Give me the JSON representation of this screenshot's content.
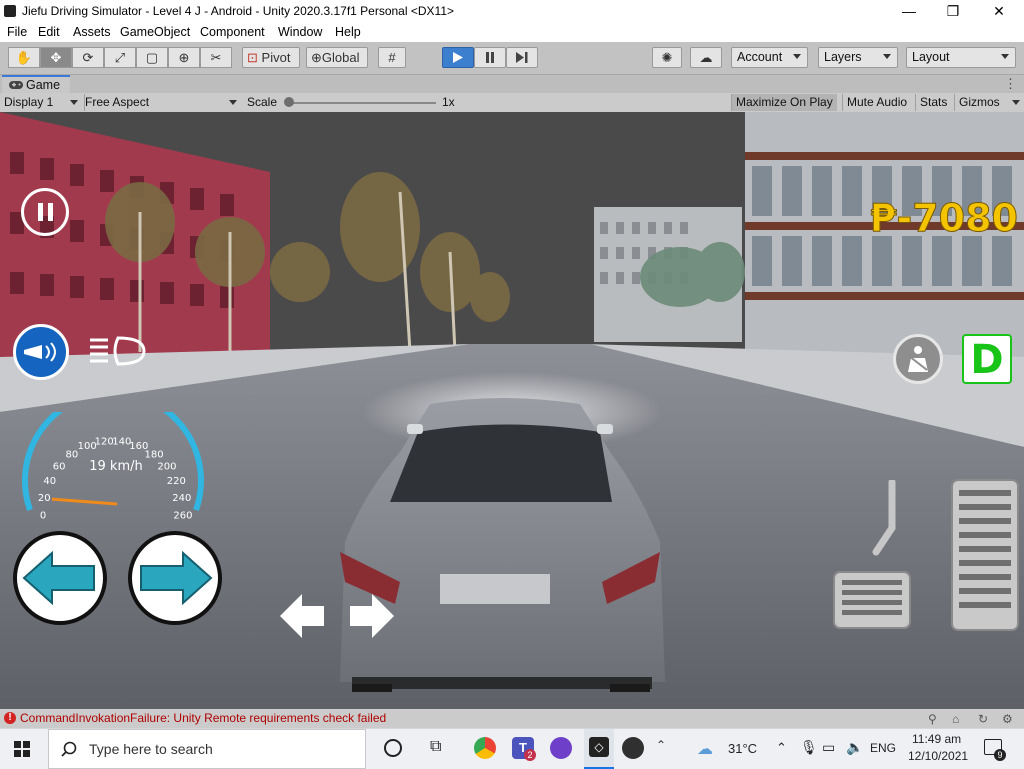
{
  "window": {
    "title": "Jiefu Driving Simulator - Level 4 J - Android - Unity 2020.3.17f1 Personal <DX11>",
    "controls": {
      "minimize": "—",
      "maximize": "❐",
      "close": "✕"
    }
  },
  "menu": {
    "items": [
      "File",
      "Edit",
      "Assets",
      "GameObject",
      "Component",
      "Window",
      "Help"
    ]
  },
  "toolbar": {
    "pivot_label": "Pivot",
    "global_label": "Global",
    "account_label": "Account",
    "layers_label": "Layers",
    "layout_label": "Layout",
    "play_state": "playing"
  },
  "game_tab": {
    "label": "Game",
    "display_label": "Display 1",
    "aspect_label": "Free Aspect",
    "scale_label": "Scale",
    "scale_value": "1x",
    "maximize_label": "Maximize On Play",
    "mute_label": "Mute Audio",
    "stats_label": "Stats",
    "gizmos_label": "Gizmos"
  },
  "hud": {
    "money": "₱-7080",
    "speed_readout": "19 km/h",
    "speed_value": 19,
    "speedometer_ticks": [
      "0",
      "20",
      "40",
      "60",
      "80",
      "100",
      "120",
      "140",
      "160",
      "180",
      "200",
      "220",
      "240",
      "260"
    ],
    "gear": "D",
    "colors": {
      "money": "#f5c400",
      "gear": "#19c419",
      "accent_ring": "#30b6e0",
      "needle": "#f08a1a",
      "arrow": "#2aa6bf"
    }
  },
  "status": {
    "message": "CommandInvokationFailure: Unity Remote requirements check failed"
  },
  "taskbar": {
    "search_placeholder": "Type here to search",
    "weather": "31°C",
    "language": "ENG",
    "time": "11:49 am",
    "date": "12/10/2021",
    "notification_count": "9",
    "teams_badge": "2"
  }
}
